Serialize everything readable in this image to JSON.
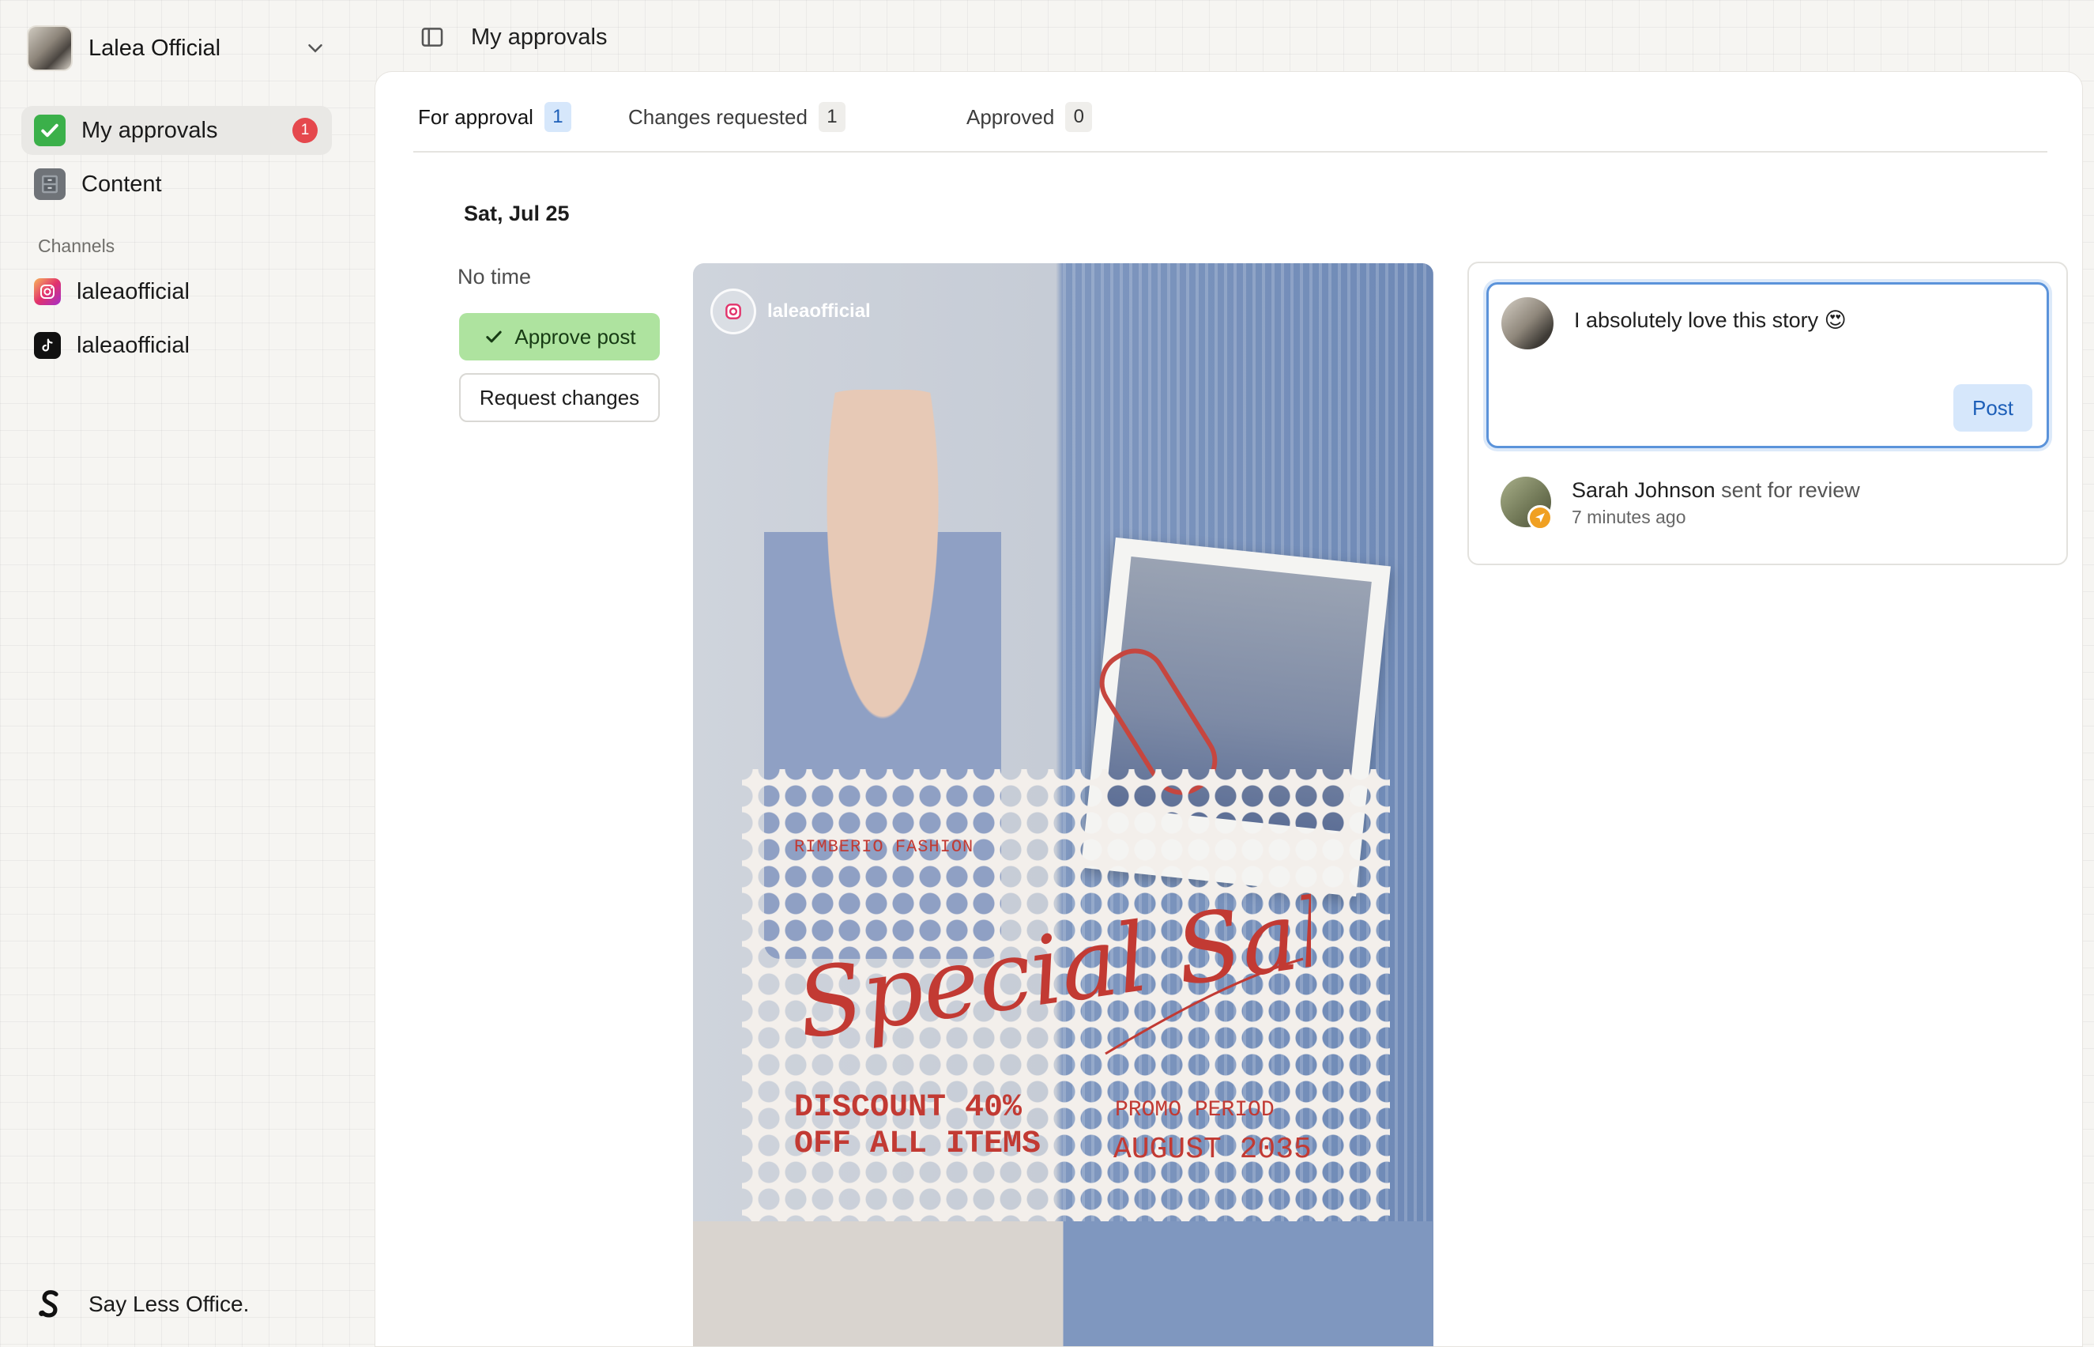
{
  "account": {
    "name": "Lalea Official"
  },
  "sidebar": {
    "items": [
      {
        "label": "My approvals",
        "icon": "check-mark-icon",
        "badge": "1"
      },
      {
        "label": "Content",
        "icon": "file-cabinet-icon"
      }
    ],
    "channels_label": "Channels",
    "channels": [
      {
        "label": "laleaofficial",
        "icon": "instagram-icon"
      },
      {
        "label": "laleaofficial",
        "icon": "tiktok-icon"
      }
    ],
    "footer": {
      "brand": "Say Less Office."
    }
  },
  "header": {
    "title": "My approvals"
  },
  "tabs": [
    {
      "label": "For approval",
      "count": "1"
    },
    {
      "label": "Changes requested",
      "count": "1"
    },
    {
      "label": "Approved",
      "count": "0"
    }
  ],
  "post": {
    "date": "Sat, Jul 25",
    "time": "No time",
    "approve_label": "Approve post",
    "request_label": "Request changes",
    "preview": {
      "handle": "laleaofficial",
      "brand": "RIMBERIO FASHION",
      "headline": "Special Sale",
      "discount_line1": "DISCOUNT 40%",
      "discount_line2": "OFF ALL ITEMS",
      "promo_label": "PROMO PERIOD",
      "promo_date": "AUGUST 2035"
    }
  },
  "comments": {
    "draft": "I absolutely love this story 😍",
    "post_label": "Post",
    "activity": {
      "user": "Sarah Johnson",
      "action": "sent for review",
      "time": "7 minutes ago"
    }
  },
  "colors": {
    "accent": "#5b93da",
    "approve_bg": "#aee39f",
    "badge_red": "#e5484d",
    "sale_red": "#c23a33"
  }
}
